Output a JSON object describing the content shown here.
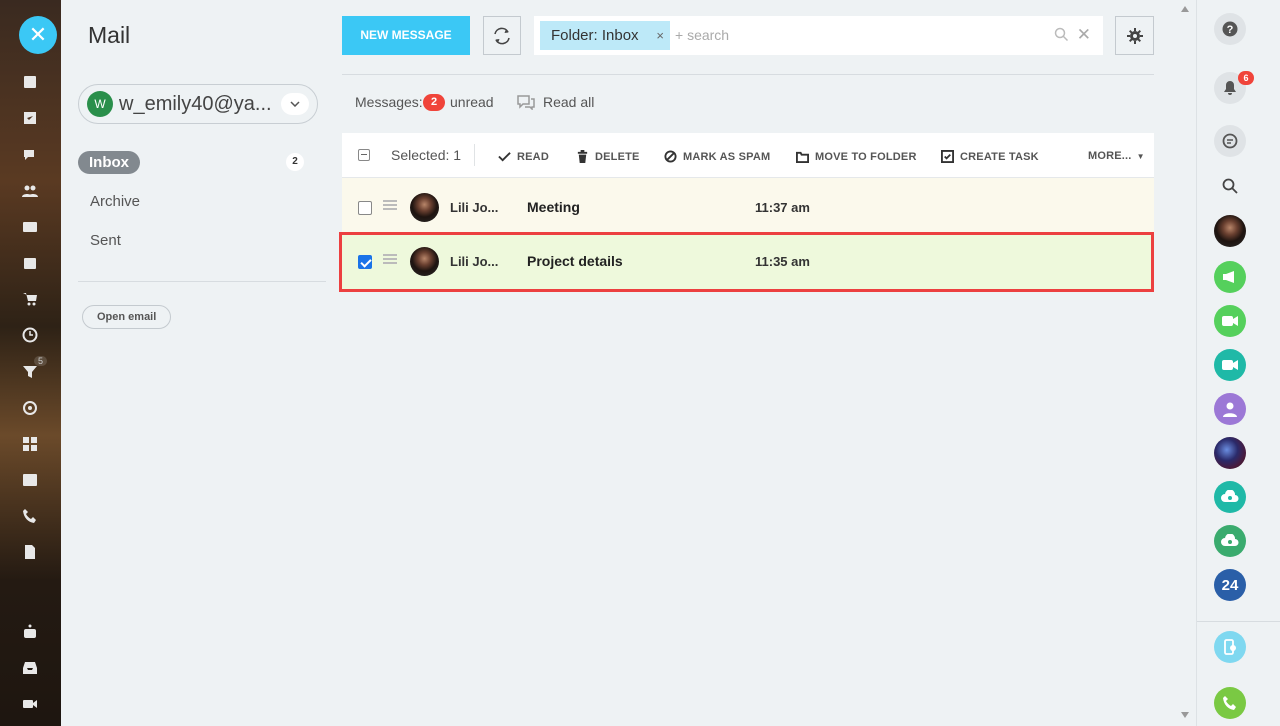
{
  "app": {
    "title": "Mail"
  },
  "account": {
    "avatar_letter": "W",
    "email": "w_emily40@ya..."
  },
  "folders": {
    "inbox": {
      "label": "Inbox",
      "count": "2"
    },
    "archive": {
      "label": "Archive"
    },
    "sent": {
      "label": "Sent"
    }
  },
  "sidebar": {
    "open_email_label": "Open email"
  },
  "toolbar": {
    "new_message_label": "NEW MESSAGE",
    "filter_chip": "Folder: Inbox",
    "filter_chip_close": "×",
    "search_placeholder": "+ search",
    "search_clear": "✕"
  },
  "counters": {
    "messages_label": "Messages:",
    "unread_count": "2",
    "unread_label": "unread",
    "read_all_label": "Read all"
  },
  "list_header": {
    "selected_label": "Selected: 1",
    "actions": {
      "read": "READ",
      "delete": "DELETE",
      "spam": "MARK AS SPAM",
      "move": "MOVE TO FOLDER",
      "task": "CREATE TASK",
      "more": "MORE..."
    }
  },
  "messages": [
    {
      "sender": "Lili Jo...",
      "subject": "Meeting",
      "time": "11:37 am",
      "selected": false
    },
    {
      "sender": "Lili Jo...",
      "subject": "Project details",
      "time": "11:35 am",
      "selected": true
    }
  ],
  "right_rail": {
    "notification_count": "6",
    "counter_24": "24"
  },
  "left_rail": {
    "close_icon": "✕",
    "badge": "5"
  },
  "colors": {
    "accent": "#3bc8f5",
    "badge_red": "#f0443a",
    "highlight": "#ec4040"
  }
}
